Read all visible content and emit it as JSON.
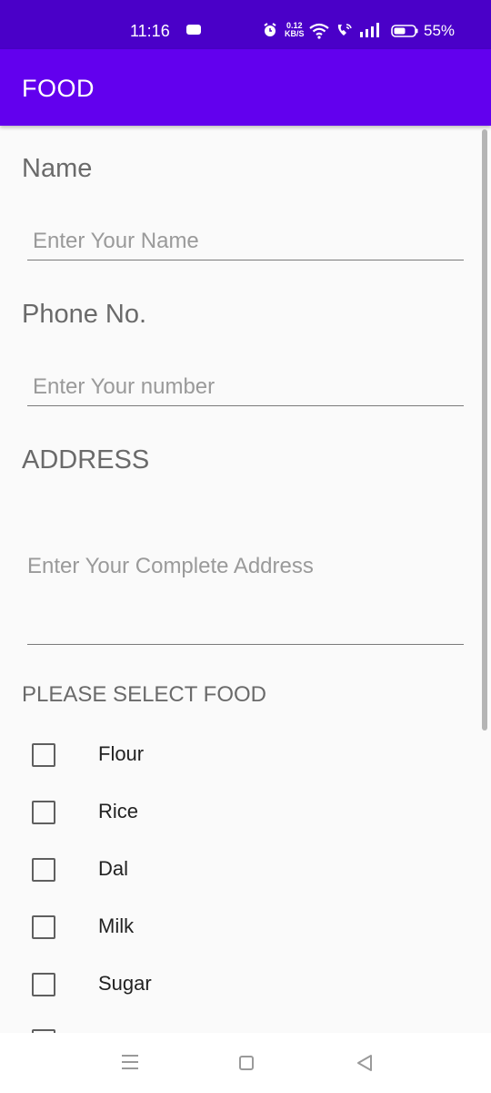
{
  "status_bar": {
    "time": "11:16",
    "speed_value": "0.12",
    "speed_unit": "KB/S",
    "battery": "55%",
    "icons": [
      "notification-icon",
      "alarm-icon",
      "wifi-icon",
      "wifi-call-icon",
      "signal-icon",
      "battery-icon"
    ]
  },
  "app_bar": {
    "title": "FOOD"
  },
  "form": {
    "name_label": "Name",
    "name_placeholder": "Enter Your Name",
    "phone_label": "Phone No.",
    "phone_placeholder": "Enter Your number",
    "address_label": "ADDRESS",
    "address_placeholder": "Enter Your Complete Address",
    "select_label": "PLEASE SELECT FOOD",
    "items": [
      {
        "label": "Flour",
        "checked": false
      },
      {
        "label": "Rice",
        "checked": false
      },
      {
        "label": "Dal",
        "checked": false
      },
      {
        "label": "Milk",
        "checked": false
      },
      {
        "label": "Sugar",
        "checked": false
      }
    ]
  },
  "colors": {
    "status_bar": "#4a00c8",
    "app_bar": "#6200ee",
    "background": "#fafafa"
  },
  "nav_bar": {
    "icons": [
      "menu-icon",
      "home-icon",
      "back-icon"
    ]
  }
}
